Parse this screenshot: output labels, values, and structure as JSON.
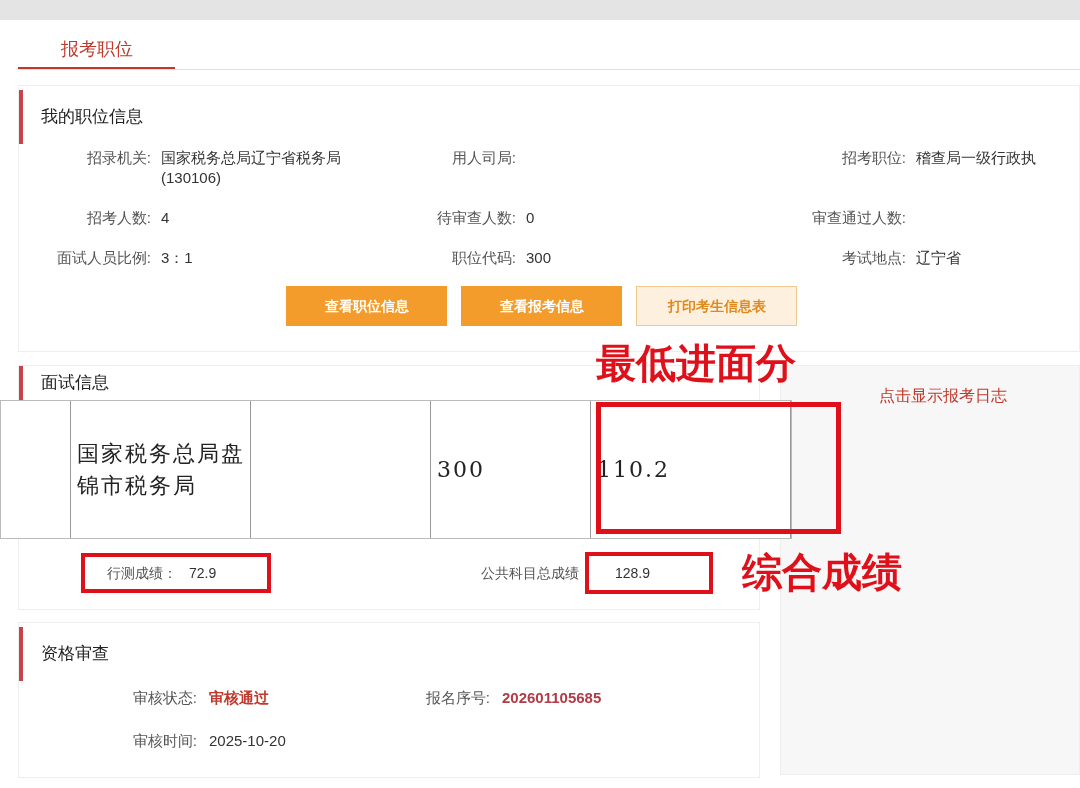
{
  "tabs": [
    {
      "label": "报考职位",
      "selected": true
    }
  ],
  "position_info": {
    "title": "我的职位信息",
    "fields": [
      {
        "label": "招录机关:",
        "value": "国家税务总局辽宁省税务局(130106)"
      },
      {
        "label": "用人司局:"
      },
      {
        "label": "招考职位:",
        "value": "稽查局一级行政执"
      },
      {
        "label": "招考人数:",
        "value": "4"
      },
      {
        "label": "待审查人数:",
        "value": "0"
      },
      {
        "label": "审查通过人数:"
      },
      {
        "label": "面试人员比例:",
        "value": "3：1"
      },
      {
        "label": "职位代码:",
        "value": "300"
      },
      {
        "label": "考试地点:",
        "value": "辽宁省"
      }
    ],
    "buttons": [
      {
        "label": "查看职位信息",
        "kind": "primary"
      },
      {
        "label": "查看报考信息",
        "kind": "primary"
      },
      {
        "label": "打印考生信息表",
        "kind": "outline"
      }
    ]
  },
  "interview": {
    "title": "面试信息",
    "pasted_table": {
      "cells": [
        "",
        "国家税务总局盘锦市税务局",
        "",
        "300",
        "110.2"
      ]
    },
    "scores": [
      {
        "label": "行测成绩：",
        "value": "72.9",
        "kind": "framed_pair"
      },
      {
        "label": "公共科目总成绩",
        "value": "128.9",
        "kind": "framed_value"
      }
    ],
    "annotations": [
      {
        "text": "最低进面分",
        "kind": "min_score"
      },
      {
        "text": "综合成绩",
        "kind": "total"
      }
    ]
  },
  "log_link": "点击显示报考日志",
  "qualification": {
    "title": "资格审查",
    "fields": [
      {
        "label": "审核状态:",
        "value": "审核通过",
        "kind": "status"
      },
      {
        "label": "报名序号:",
        "value": "202601105685",
        "kind": "number"
      },
      {
        "label": "审核时间:",
        "value": "2025-10-20",
        "kind": "plain"
      }
    ]
  }
}
